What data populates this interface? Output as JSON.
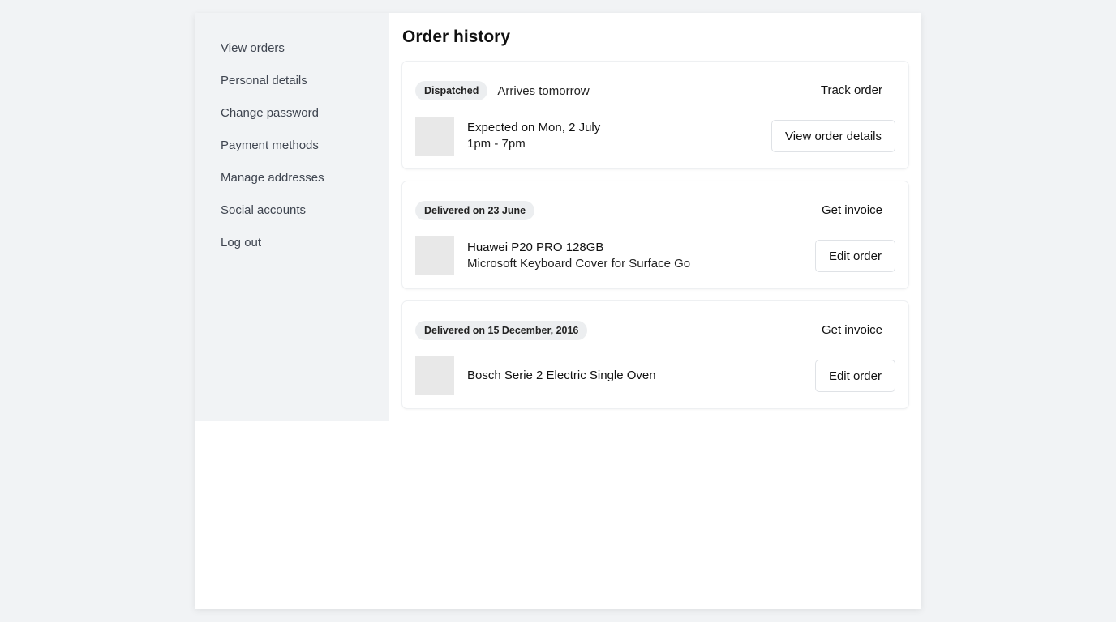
{
  "sidebar": {
    "items": [
      {
        "label": "View orders"
      },
      {
        "label": "Personal details"
      },
      {
        "label": "Change password"
      },
      {
        "label": "Payment methods"
      },
      {
        "label": "Manage addresses"
      },
      {
        "label": "Social accounts"
      },
      {
        "label": "Log out"
      }
    ]
  },
  "main": {
    "title": "Order history",
    "orders": [
      {
        "status": "Dispatched",
        "arrival": "Arrives tomorrow",
        "top_action": "Track order",
        "line1": "Expected on Mon, 2 July",
        "line2": "1pm - 7pm",
        "button": "View order details"
      },
      {
        "status": "Delivered on 23 June",
        "top_action": "Get invoice",
        "line1": "Huawei P20 PRO 128GB",
        "line2": "Microsoft Keyboard Cover for Surface Go",
        "button": "Edit order"
      },
      {
        "status": "Delivered on 15 December, 2016",
        "top_action": "Get invoice",
        "line1": "Bosch Serie 2 Electric Single Oven",
        "line2": "",
        "button": "Edit order"
      }
    ]
  }
}
